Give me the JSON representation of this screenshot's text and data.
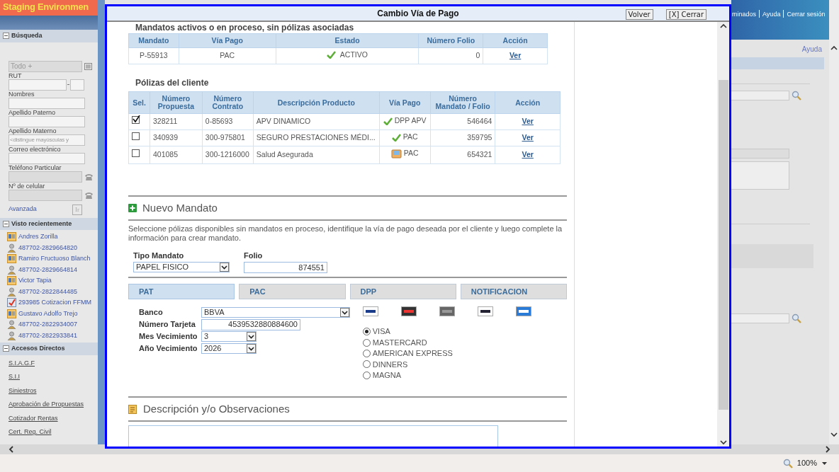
{
  "environment_banner": "Staging Environmen",
  "sidebar": {
    "search": {
      "title": "Búsqueda",
      "expanded": true,
      "scope": "Todo +",
      "fields": [
        {
          "label": "RUT",
          "kind": "rut"
        },
        {
          "label": "Nombres",
          "kind": "text"
        },
        {
          "label": "Apellido Paterno",
          "kind": "text"
        },
        {
          "label": "Apellido Materno",
          "kind": "text",
          "placeholder": "<distingue mayúsculas y"
        },
        {
          "label": "Correo electrónico",
          "kind": "text"
        },
        {
          "label": "Teléfono Particular",
          "kind": "phone"
        },
        {
          "label": "Nº de celular",
          "kind": "phone"
        }
      ],
      "advanced_link": "Avanzada",
      "go_button": "Ir"
    },
    "recent": {
      "title": "Visto recientemente",
      "expanded": true,
      "items": [
        {
          "label": "Andres Zorilla",
          "kind": "contact"
        },
        {
          "label": "487702-2829664820",
          "kind": "person"
        },
        {
          "label": "Ramiro Fructuoso Blanch",
          "kind": "contact"
        },
        {
          "label": "487702-2829664814",
          "kind": "person"
        },
        {
          "label": "Victor Tapia",
          "kind": "contact"
        },
        {
          "label": "487702-2822844485",
          "kind": "person"
        },
        {
          "label": "293985 Cotizacion FFMM",
          "kind": "quote"
        },
        {
          "label": "Gustavo Adolfo Trejo",
          "kind": "contact"
        },
        {
          "label": "487702-2822934007",
          "kind": "person"
        },
        {
          "label": "487702-2822933841",
          "kind": "person"
        }
      ]
    },
    "shortcuts": {
      "title": "Accesos Directos",
      "expanded": true,
      "links": [
        "S.I.A.G.F",
        "S.I.I",
        "Siniestros",
        "Aprobación de Propuestas",
        "Cotizador Rentas",
        "Cert. Reg. Civil"
      ]
    }
  },
  "header_links": [
    "minados",
    "Ayuda",
    "Cerrar sesión"
  ],
  "help_link": "Ayuda",
  "dialog": {
    "title": "Cambio Vía de Pago",
    "buttons": [
      "Volver",
      "[X] Cerrar"
    ],
    "mandates": {
      "title": "Mandatos activos o en proceso, sin pólizas asociadas",
      "columns": [
        "Mandato",
        "Vía Pago",
        "Estado",
        "Número Folio",
        "Acción"
      ],
      "rows": [
        {
          "mandato": "P-55913",
          "via_pago": "PAC",
          "estado": "ACTIVO",
          "kind": "check",
          "numero_folio": "0",
          "accion": "Ver"
        }
      ]
    },
    "policies": {
      "title": "Pólizas del cliente",
      "columns": [
        "Sel.",
        "Número Propuesta",
        "Número Contrato",
        "Descripción Producto",
        "Vía Pago",
        "Número Mandato / Folio",
        "Acción"
      ],
      "rows": [
        {
          "selected": true,
          "propuesta": "328211",
          "contrato": "0-85693",
          "descripcion": "APV DINAMICO",
          "kind": "check",
          "via_pago": "DPP APV",
          "mandato_folio": "546464",
          "accion": "Ver"
        },
        {
          "selected": false,
          "propuesta": "340939",
          "contrato": "300-975801",
          "descripcion": "SEGURO PRESTACIONES MÉDI...",
          "kind": "check",
          "via_pago": "PAC",
          "mandato_folio": "359795",
          "accion": "Ver"
        },
        {
          "selected": false,
          "propuesta": "401085",
          "contrato": "300-1216000",
          "descripcion": "Salud Asegurada",
          "kind": "tray",
          "via_pago": "PAC",
          "mandato_folio": "654321",
          "accion": "Ver"
        }
      ]
    },
    "new_mandate": {
      "title": "Nuevo Mandato",
      "instructions": "Seleccione pólizas disponibles sin mandatos en proceso, identifique la vía de pago deseada por el cliente y luego complete la información para crear mandato.",
      "tipo_mandato": {
        "label": "Tipo Mandato",
        "value": "PAPEL FISICO"
      },
      "folio": {
        "label": "Folio",
        "value": "874551"
      },
      "tabs": [
        {
          "label": "PAT",
          "selected": true
        },
        {
          "label": "PAC",
          "selected": false
        },
        {
          "label": "DPP",
          "selected": false
        },
        {
          "label": "NOTIFICACION",
          "selected": false
        }
      ],
      "fields": [
        {
          "label": "Banco",
          "value": "BBVA",
          "kind": "select"
        },
        {
          "label": "Número Tarjeta",
          "value": "4539532880884600",
          "kind": "input"
        },
        {
          "label": "Mes Vecimiento",
          "value": "3",
          "kind": "select"
        },
        {
          "label": "Año Vecimiento",
          "value": "2026",
          "kind": "select"
        }
      ],
      "card_types": [
        {
          "label": "VISA",
          "selected": true
        },
        {
          "label": "MASTERCARD",
          "selected": false
        },
        {
          "label": "AMERICAN EXPRESS",
          "selected": false
        },
        {
          "label": "DINNERS",
          "selected": false
        },
        {
          "label": "MAGNA",
          "selected": false
        }
      ]
    },
    "observations": {
      "title": "Descripción y/o Observaciones"
    }
  },
  "status_bar": {
    "zoom": "100%"
  }
}
